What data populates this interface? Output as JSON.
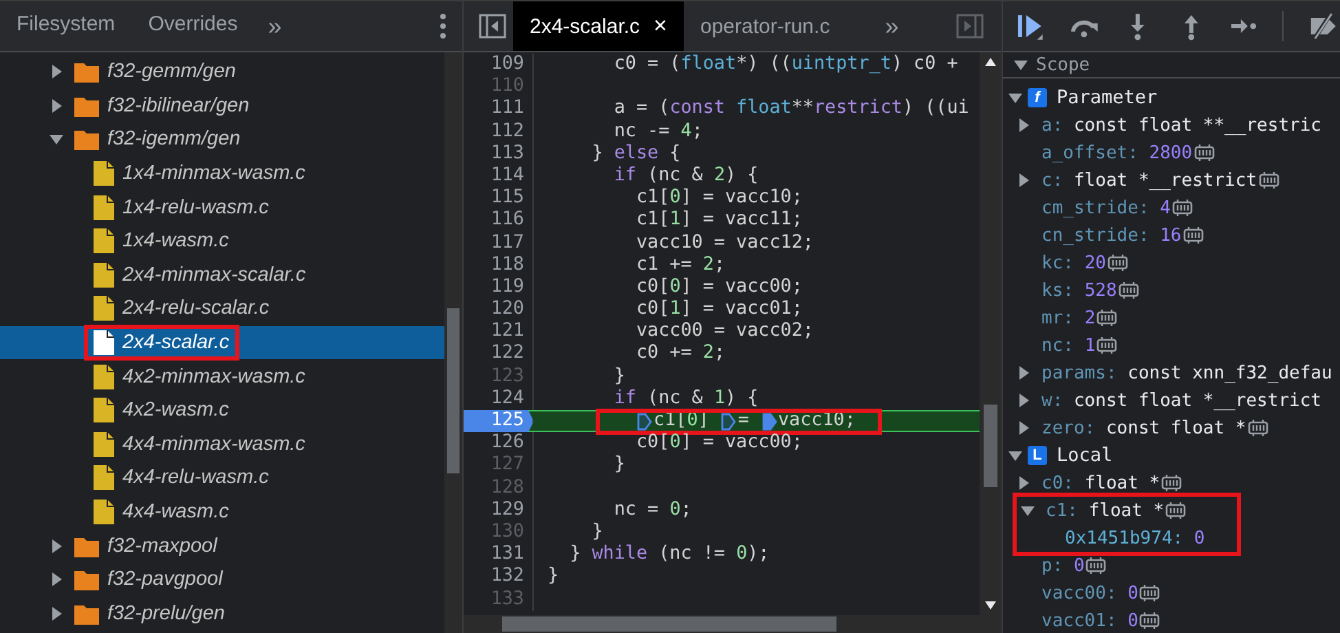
{
  "navigator": {
    "tabs": [
      {
        "label": "Filesystem",
        "selected": false
      },
      {
        "label": "Overrides",
        "selected": false
      }
    ],
    "more": "»"
  },
  "tree": [
    {
      "label": "f32-gemm/gen",
      "kind": "folder",
      "expanded": false,
      "selected": false,
      "highlighted": false
    },
    {
      "label": "f32-ibilinear/gen",
      "kind": "folder",
      "expanded": false,
      "selected": false,
      "highlighted": false
    },
    {
      "label": "f32-igemm/gen",
      "kind": "folder",
      "expanded": true,
      "selected": false,
      "highlighted": false,
      "children": [
        {
          "label": "1x4-minmax-wasm.c",
          "kind": "file",
          "selected": false,
          "highlighted": false
        },
        {
          "label": "1x4-relu-wasm.c",
          "kind": "file",
          "selected": false,
          "highlighted": false
        },
        {
          "label": "1x4-wasm.c",
          "kind": "file",
          "selected": false,
          "highlighted": false
        },
        {
          "label": "2x4-minmax-scalar.c",
          "kind": "file",
          "selected": false,
          "highlighted": false
        },
        {
          "label": "2x4-relu-scalar.c",
          "kind": "file",
          "selected": false,
          "highlighted": false
        },
        {
          "label": "2x4-scalar.c",
          "kind": "file",
          "selected": true,
          "highlighted": true
        },
        {
          "label": "4x2-minmax-wasm.c",
          "kind": "file",
          "selected": false,
          "highlighted": false
        },
        {
          "label": "4x2-wasm.c",
          "kind": "file",
          "selected": false,
          "highlighted": false
        },
        {
          "label": "4x4-minmax-wasm.c",
          "kind": "file",
          "selected": false,
          "highlighted": false
        },
        {
          "label": "4x4-relu-wasm.c",
          "kind": "file",
          "selected": false,
          "highlighted": false
        },
        {
          "label": "4x4-wasm.c",
          "kind": "file",
          "selected": false,
          "highlighted": false
        }
      ]
    },
    {
      "label": "f32-maxpool",
      "kind": "folder",
      "expanded": false,
      "selected": false,
      "highlighted": false
    },
    {
      "label": "f32-pavgpool",
      "kind": "folder",
      "expanded": false,
      "selected": false,
      "highlighted": false
    },
    {
      "label": "f32-prelu/gen",
      "kind": "folder",
      "expanded": false,
      "selected": false,
      "highlighted": false
    }
  ],
  "editor": {
    "tabs": [
      {
        "label": "2x4-scalar.c",
        "selected": true,
        "close": "×"
      },
      {
        "label": "operator-run.c",
        "selected": false
      }
    ],
    "more": "»",
    "lines": [
      {
        "number": "109",
        "executable": true,
        "current": false,
        "tokens": [
          {
            "kind": "plain",
            "text": "      c0 = ("
          },
          {
            "kind": "type",
            "text": "float"
          },
          {
            "kind": "plain",
            "text": "*) (("
          },
          {
            "kind": "type",
            "text": "uintptr_t"
          },
          {
            "kind": "plain",
            "text": ") c0 +"
          }
        ]
      },
      {
        "number": "110",
        "executable": false,
        "current": false
      },
      {
        "number": "111",
        "executable": true,
        "current": false,
        "tokens": [
          {
            "kind": "plain",
            "text": "      a = ("
          },
          {
            "kind": "keyword",
            "text": "const"
          },
          {
            "kind": "type",
            "text": " float"
          },
          {
            "kind": "plain",
            "text": "**"
          },
          {
            "kind": "keyword",
            "text": "restrict"
          },
          {
            "kind": "plain",
            "text": ") ((ui"
          }
        ]
      },
      {
        "number": "112",
        "executable": true,
        "current": false,
        "tokens": [
          {
            "kind": "plain",
            "text": "      nc -= "
          },
          {
            "kind": "number",
            "text": "4"
          },
          {
            "kind": "plain",
            "text": ";"
          }
        ]
      },
      {
        "number": "113",
        "executable": true,
        "current": false,
        "tokens": [
          {
            "kind": "plain",
            "text": "    } "
          },
          {
            "kind": "keyword",
            "text": "else"
          },
          {
            "kind": "plain",
            "text": " {"
          }
        ]
      },
      {
        "number": "114",
        "executable": true,
        "current": false,
        "tokens": [
          {
            "kind": "keyword",
            "text": "      if"
          },
          {
            "kind": "plain",
            "text": " (nc & "
          },
          {
            "kind": "number",
            "text": "2"
          },
          {
            "kind": "plain",
            "text": ") {"
          }
        ]
      },
      {
        "number": "115",
        "executable": true,
        "current": false,
        "tokens": [
          {
            "kind": "plain",
            "text": "        c1["
          },
          {
            "kind": "number",
            "text": "0"
          },
          {
            "kind": "plain",
            "text": "] = vacc10;"
          }
        ]
      },
      {
        "number": "116",
        "executable": true,
        "current": false,
        "tokens": [
          {
            "kind": "plain",
            "text": "        c1["
          },
          {
            "kind": "number",
            "text": "1"
          },
          {
            "kind": "plain",
            "text": "] = vacc11;"
          }
        ]
      },
      {
        "number": "117",
        "executable": true,
        "current": false,
        "tokens": [
          {
            "kind": "plain",
            "text": "        vacc10 = vacc12;"
          }
        ]
      },
      {
        "number": "118",
        "executable": true,
        "current": false,
        "tokens": [
          {
            "kind": "plain",
            "text": "        c1 += "
          },
          {
            "kind": "number",
            "text": "2"
          },
          {
            "kind": "plain",
            "text": ";"
          }
        ]
      },
      {
        "number": "119",
        "executable": true,
        "current": false,
        "tokens": [
          {
            "kind": "plain",
            "text": "        c0["
          },
          {
            "kind": "number",
            "text": "0"
          },
          {
            "kind": "plain",
            "text": "] = vacc00;"
          }
        ]
      },
      {
        "number": "120",
        "executable": true,
        "current": false,
        "tokens": [
          {
            "kind": "plain",
            "text": "        c0["
          },
          {
            "kind": "number",
            "text": "1"
          },
          {
            "kind": "plain",
            "text": "] = vacc01;"
          }
        ]
      },
      {
        "number": "121",
        "executable": true,
        "current": false,
        "tokens": [
          {
            "kind": "plain",
            "text": "        vacc00 = vacc02;"
          }
        ]
      },
      {
        "number": "122",
        "executable": true,
        "current": false,
        "tokens": [
          {
            "kind": "plain",
            "text": "        c0 += "
          },
          {
            "kind": "number",
            "text": "2"
          },
          {
            "kind": "plain",
            "text": ";"
          }
        ]
      },
      {
        "number": "123",
        "executable": false,
        "current": false,
        "tokens": [
          {
            "kind": "plain",
            "text": "      }"
          }
        ]
      },
      {
        "number": "124",
        "executable": true,
        "current": false,
        "tokens": [
          {
            "kind": "keyword",
            "text": "      if"
          },
          {
            "kind": "plain",
            "text": " (nc & "
          },
          {
            "kind": "number",
            "text": "1"
          },
          {
            "kind": "plain",
            "text": ") {"
          }
        ]
      },
      {
        "number": "125",
        "executable": true,
        "current": true,
        "highlighted": true,
        "tokens": [
          {
            "kind": "marker",
            "active": false
          },
          {
            "kind": "plain",
            "text": "c1["
          },
          {
            "kind": "number",
            "text": "0"
          },
          {
            "kind": "plain",
            "text": "] "
          },
          {
            "kind": "marker",
            "active": false
          },
          {
            "kind": "plain",
            "text": "= "
          },
          {
            "kind": "marker",
            "active": true
          },
          {
            "kind": "plain",
            "text": "vacc10;"
          }
        ]
      },
      {
        "number": "126",
        "executable": true,
        "current": false,
        "tokens": [
          {
            "kind": "plain",
            "text": "        c0["
          },
          {
            "kind": "number",
            "text": "0"
          },
          {
            "kind": "plain",
            "text": "] = vacc00;"
          }
        ]
      },
      {
        "number": "127",
        "executable": false,
        "current": false,
        "tokens": [
          {
            "kind": "plain",
            "text": "      }"
          }
        ]
      },
      {
        "number": "128",
        "executable": false,
        "current": false
      },
      {
        "number": "129",
        "executable": true,
        "current": false,
        "tokens": [
          {
            "kind": "plain",
            "text": "      nc = "
          },
          {
            "kind": "number",
            "text": "0"
          },
          {
            "kind": "plain",
            "text": ";"
          }
        ]
      },
      {
        "number": "130",
        "executable": false,
        "current": false,
        "tokens": [
          {
            "kind": "plain",
            "text": "    }"
          }
        ]
      },
      {
        "number": "131",
        "executable": true,
        "current": false,
        "tokens": [
          {
            "kind": "plain",
            "text": "  } "
          },
          {
            "kind": "keyword",
            "text": "while"
          },
          {
            "kind": "plain",
            "text": " (nc != "
          },
          {
            "kind": "number",
            "text": "0"
          },
          {
            "kind": "plain",
            "text": ");"
          }
        ]
      },
      {
        "number": "132",
        "executable": true,
        "current": false,
        "tokens": [
          {
            "kind": "plain",
            "text": "}"
          }
        ]
      },
      {
        "number": "133",
        "executable": false,
        "current": false
      }
    ]
  },
  "scope": {
    "title": "Scope",
    "groups": [
      {
        "label": "Parameter",
        "badge": "f",
        "expanded": true,
        "entries": [
          {
            "name": "a:",
            "value": "const float **__restric",
            "kind": "type",
            "expandable": true,
            "expanded": false,
            "memory": false,
            "highlighted": false
          },
          {
            "name": "a_offset:",
            "value": "2800",
            "kind": "number",
            "expandable": false,
            "expanded": false,
            "memory": true,
            "highlighted": false
          },
          {
            "name": "c:",
            "value": "float *__restrict",
            "kind": "type",
            "expandable": true,
            "expanded": false,
            "memory": true,
            "highlighted": false
          },
          {
            "name": "cm_stride:",
            "value": "4",
            "kind": "number",
            "expandable": false,
            "expanded": false,
            "memory": true,
            "highlighted": false
          },
          {
            "name": "cn_stride:",
            "value": "16",
            "kind": "number",
            "expandable": false,
            "expanded": false,
            "memory": true,
            "highlighted": false
          },
          {
            "name": "kc:",
            "value": "20",
            "kind": "number",
            "expandable": false,
            "expanded": false,
            "memory": true,
            "highlighted": false
          },
          {
            "name": "ks:",
            "value": "528",
            "kind": "number",
            "expandable": false,
            "expanded": false,
            "memory": true,
            "highlighted": false
          },
          {
            "name": "mr:",
            "value": "2",
            "kind": "number",
            "expandable": false,
            "expanded": false,
            "memory": true,
            "highlighted": false
          },
          {
            "name": "nc:",
            "value": "1",
            "kind": "number",
            "expandable": false,
            "expanded": false,
            "memory": true,
            "highlighted": false
          },
          {
            "name": "params:",
            "value": "const xnn_f32_defau",
            "kind": "type",
            "expandable": true,
            "expanded": false,
            "memory": false,
            "highlighted": false
          },
          {
            "name": "w:",
            "value": "const float *__restrict",
            "kind": "type",
            "expandable": true,
            "expanded": false,
            "memory": false,
            "highlighted": false
          },
          {
            "name": "zero:",
            "value": "const float *",
            "kind": "type",
            "expandable": true,
            "expanded": false,
            "memory": true,
            "highlighted": false
          }
        ]
      },
      {
        "label": "Local",
        "badge": "L",
        "expanded": true,
        "entries": [
          {
            "name": "c0:",
            "value": "float *",
            "kind": "type",
            "expandable": true,
            "expanded": false,
            "memory": true,
            "highlighted": false
          },
          {
            "name": "c1:",
            "value": "float *",
            "kind": "type",
            "expandable": true,
            "expanded": true,
            "memory": true,
            "highlighted": true,
            "children": [
              {
                "name": "0x1451b974:",
                "value": "0",
                "kind": "number"
              }
            ]
          },
          {
            "name": "p:",
            "value": "0",
            "kind": "number",
            "expandable": false,
            "expanded": false,
            "memory": true,
            "highlighted": false
          },
          {
            "name": "vacc00:",
            "value": "0",
            "kind": "number",
            "expandable": false,
            "expanded": false,
            "memory": true,
            "highlighted": false
          },
          {
            "name": "vacc01:",
            "value": "0",
            "kind": "number",
            "expandable": false,
            "expanded": false,
            "memory": true,
            "highlighted": false
          }
        ]
      }
    ]
  }
}
